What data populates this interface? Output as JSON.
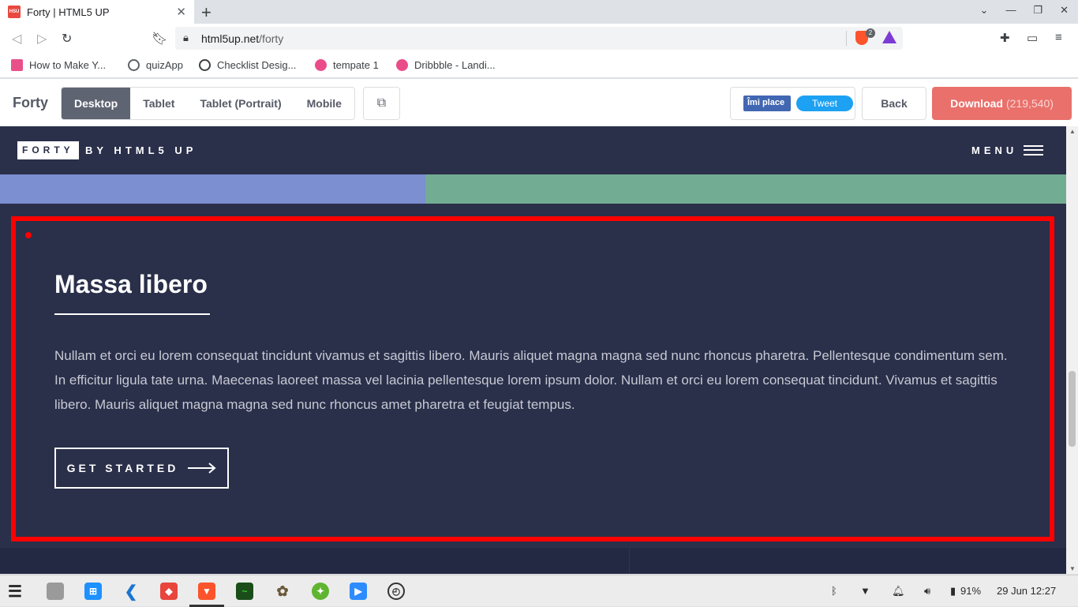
{
  "browser": {
    "tab_title": "Forty | HTML5 UP",
    "tab_favicon_text": "HSU",
    "new_tab_label": "+",
    "url_host": "html5up.net",
    "url_path": "/forty",
    "shield_count": "2",
    "bookmarks": [
      {
        "label": "How to Make Y...",
        "color": "#e9508a"
      },
      {
        "label": "quizApp",
        "color": "#5f6368"
      },
      {
        "label": "Checklist Desig...",
        "color": "#3c4043"
      },
      {
        "label": "tempate 1",
        "color": "#ea4c89"
      },
      {
        "label": "Dribbble - Landi...",
        "color": "#ea4c89"
      }
    ]
  },
  "demo_bar": {
    "logo": "Forty",
    "viewports": [
      "Desktop",
      "Tablet",
      "Tablet (Portrait)",
      "Mobile"
    ],
    "active_viewport": "Desktop",
    "fb_like": "Îmi place",
    "tweet": "Tweet",
    "back": "Back",
    "download": "Download",
    "download_count": "(219,540)"
  },
  "site": {
    "logo": "FORTY",
    "logo_by": "BY HTML5 UP",
    "menu": "MENU",
    "section": {
      "title": "Massa libero",
      "body": "Nullam et orci eu lorem consequat tincidunt vivamus et sagittis libero. Mauris aliquet magna magna sed nunc rhoncus pharetra. Pellentesque condimentum sem. In efficitur ligula tate urna. Maecenas laoreet massa vel lacinia pellentesque lorem ipsum dolor. Nullam et orci eu lorem consequat tincidunt. Vivamus et sagittis libero. Mauris aliquet magna magna sed nunc rhoncus amet pharetra et feugiat tempus.",
      "cta": "GET STARTED"
    }
  },
  "taskbar": {
    "battery": "91%",
    "datetime": "29 Jun 12:27"
  },
  "colors": {
    "page_bg": "#242943",
    "section_bg": "#2a2f4a",
    "download_accent": "#e9706b",
    "highlight": "#ff0000"
  }
}
